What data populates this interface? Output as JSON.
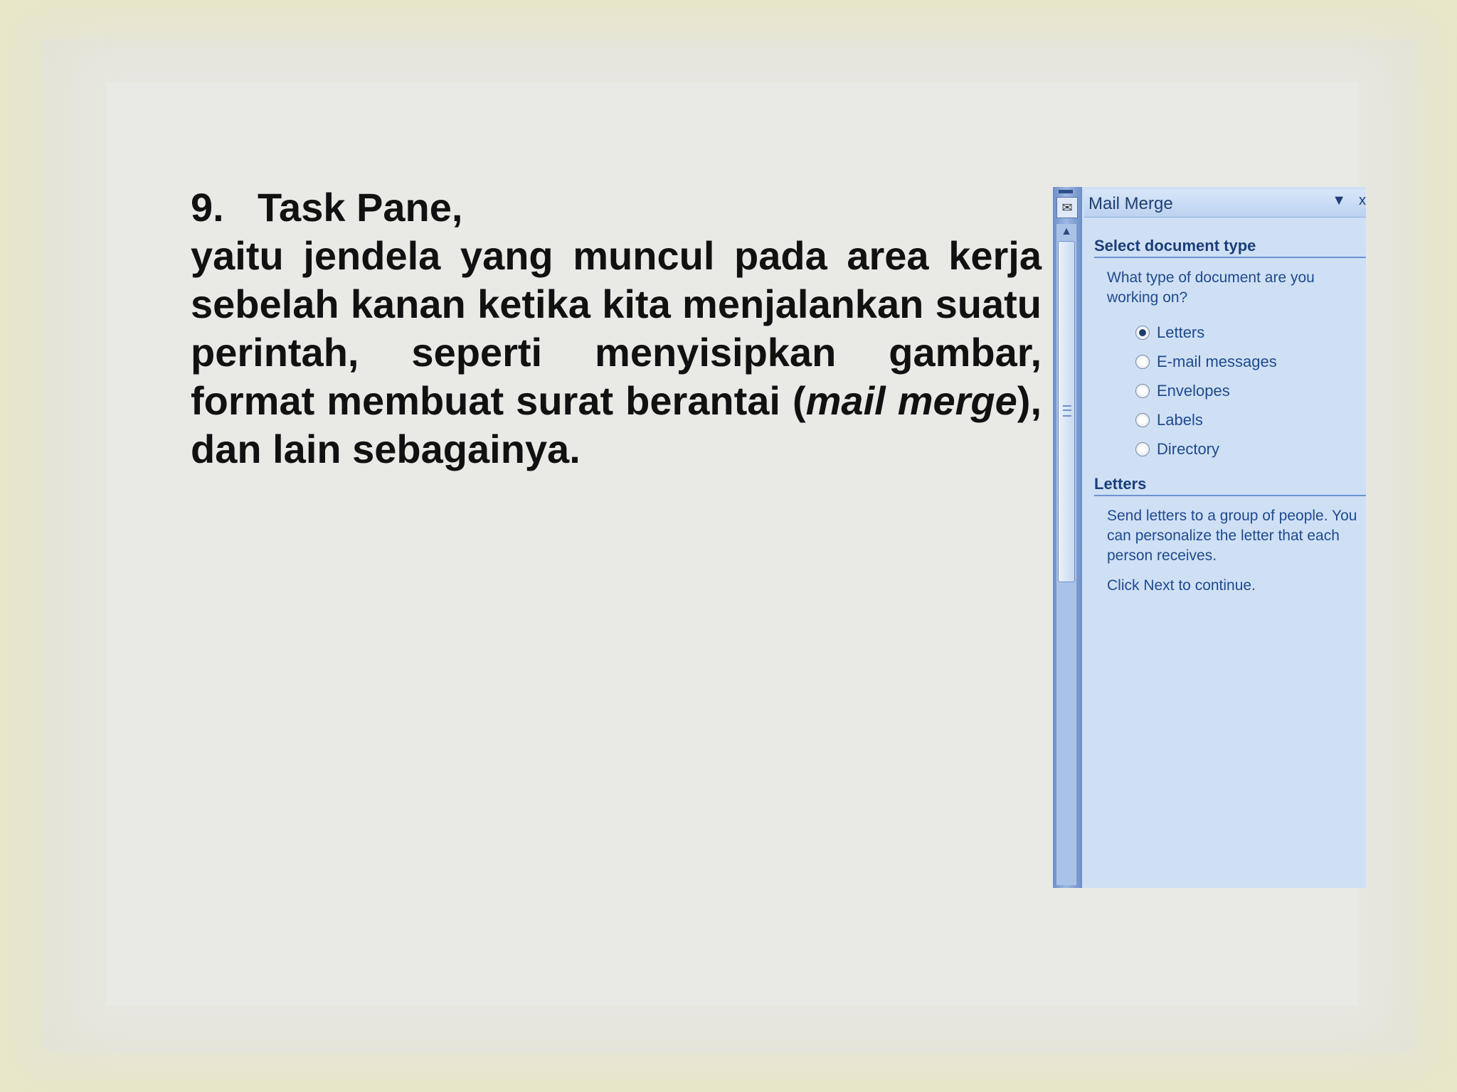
{
  "slide": {
    "heading_number": "9.",
    "heading_text": "Task Pane,",
    "body_part1": "yaitu jendela yang muncul pada area kerja sebelah kanan ketika kita menjalankan suatu perintah, seperti menyisipkan gambar, format membuat surat berantai (",
    "body_italic": "mail merge",
    "body_part2": "), dan lain sebagainya."
  },
  "task_pane": {
    "title": "Mail Merge",
    "dropdown_icon": "▼",
    "close_icon": "x",
    "section1": {
      "heading": "Select document type",
      "question": "What type of document are you working on?",
      "options": [
        {
          "label": "Letters",
          "checked": true
        },
        {
          "label": "E-mail messages",
          "checked": false
        },
        {
          "label": "Envelopes",
          "checked": false
        },
        {
          "label": "Labels",
          "checked": false
        },
        {
          "label": "Directory",
          "checked": false
        }
      ]
    },
    "section2": {
      "heading": "Letters",
      "description": "Send letters to a group of people. You can personalize the letter that each person receives.",
      "instruction": "Click Next to continue."
    }
  }
}
